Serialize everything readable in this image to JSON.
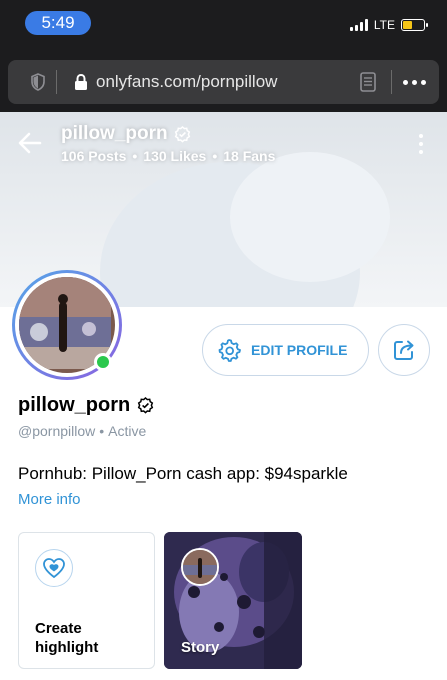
{
  "status_bar": {
    "time": "5:49",
    "network": "LTE"
  },
  "browser": {
    "url": "onlyfans.com/pornpillow"
  },
  "header": {
    "name": "pillow_porn",
    "posts": "106 Posts",
    "likes": "130 Likes",
    "fans": "18 Fans"
  },
  "actions": {
    "edit_profile": "EDIT PROFILE"
  },
  "profile": {
    "name": "pillow_porn",
    "handle": "@pornpillow",
    "status": "Active",
    "bio": "Pornhub: Pillow_Porn cash app: $94sparkle",
    "more_info": "More info"
  },
  "highlights": {
    "create_label_line1": "Create",
    "create_label_line2": "highlight",
    "story_label": "Story"
  },
  "colors": {
    "accent": "#3193d6",
    "online": "#2bc84d",
    "time_pill": "#3a7be5"
  }
}
